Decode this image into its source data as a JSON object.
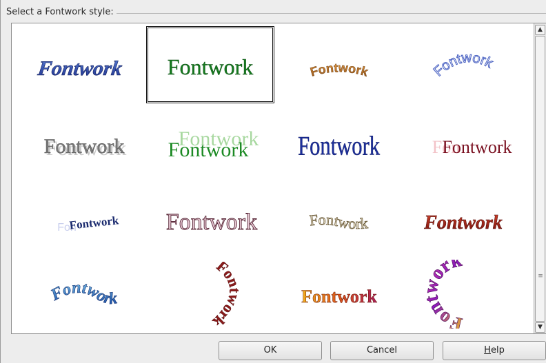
{
  "dialog": {
    "group_label": "Select a Fontwork style:"
  },
  "gallery": {
    "items": [
      {
        "text": "Fontwork",
        "style": "arch-blue-italic"
      },
      {
        "text": "Fontwork",
        "style": "green-plain",
        "selected": true
      },
      {
        "text": "Fontwork",
        "style": "orange-arc"
      },
      {
        "text": "Fontwork",
        "style": "outline-blue-arc"
      },
      {
        "text": "Fontwork",
        "style": "gray-shadow"
      },
      {
        "text": "Fontwork",
        "style": "green-double"
      },
      {
        "text": "Fontwork",
        "style": "blue-condensed"
      },
      {
        "text": "Fontwork",
        "style": "maroon-fade"
      },
      {
        "text": "Fontwork",
        "style": "navy-perspective"
      },
      {
        "text": "Fontwork",
        "style": "mauve-outline"
      },
      {
        "text": "Fontwork",
        "style": "tan-wave"
      },
      {
        "text": "Fontwork",
        "style": "red-bold"
      },
      {
        "text": "Fontwork",
        "style": "blue-wave-3d"
      },
      {
        "text": "Fontwork",
        "style": "maroon-curve"
      },
      {
        "text": "Fontwork",
        "style": "orange-gradient"
      },
      {
        "text": "Fontwork",
        "style": "purple-circle"
      }
    ]
  },
  "scrollbar": {
    "up_arrow": "▲",
    "down_arrow": "▼",
    "grip": "≡"
  },
  "buttons": {
    "ok": "OK",
    "cancel": "Cancel",
    "help_mnemonic": "H",
    "help_rest": "elp"
  },
  "colors": {
    "dialog_bg": "#ededed",
    "gallery_bg": "#ffffff",
    "selection_border": "#1a1a1a"
  }
}
